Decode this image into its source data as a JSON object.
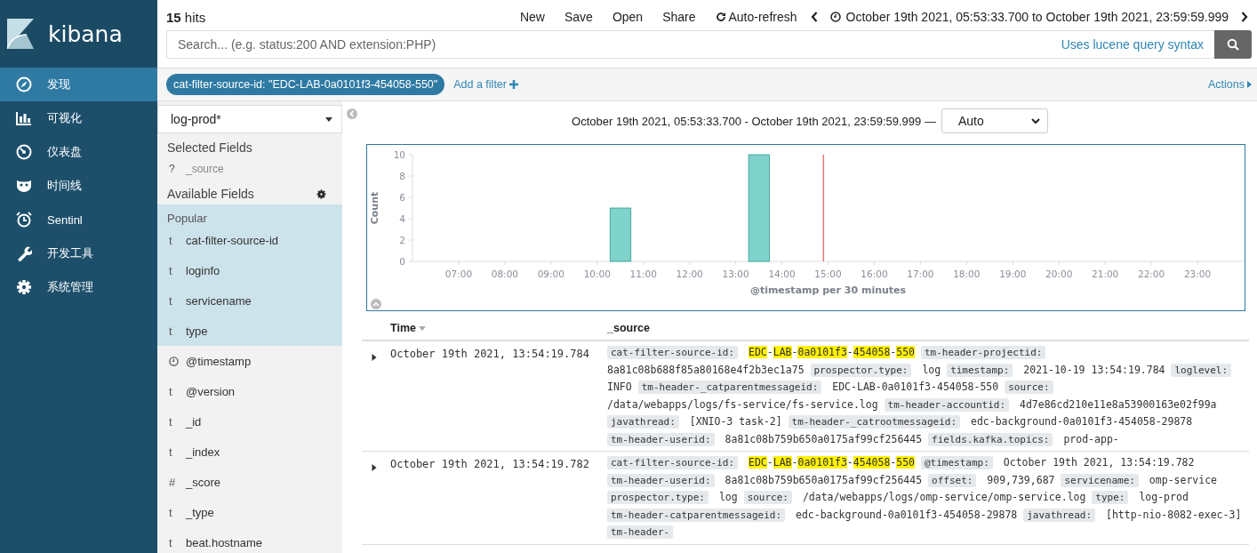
{
  "logo": {
    "text": "kibana"
  },
  "nav": [
    {
      "label": "发现",
      "kind": "discover",
      "selected": true
    },
    {
      "label": "可视化",
      "kind": "visualize",
      "selected": false
    },
    {
      "label": "仪表盘",
      "kind": "dashboard",
      "selected": false
    },
    {
      "label": "时间线",
      "kind": "timeline",
      "selected": false
    },
    {
      "label": "Sentinl",
      "kind": "alerts",
      "selected": false
    },
    {
      "label": "开发工具",
      "kind": "devtools",
      "selected": false
    },
    {
      "label": "系统管理",
      "kind": "management",
      "selected": false
    }
  ],
  "hits": "**15** hits",
  "menu": [
    {
      "label": "New",
      "kind": "plain"
    },
    {
      "label": "Save",
      "kind": "plain"
    },
    {
      "label": "Open",
      "kind": "plain"
    },
    {
      "label": "Share",
      "kind": "plain"
    },
    {
      "label": "Auto-refresh",
      "kind": "refresh"
    }
  ],
  "time_range": "October 19th 2021, 05:53:33.700 to October 19th 2021, 23:59:59.999",
  "search": {
    "placeholder": "Search... (e.g. status:200 AND extension:PHP)",
    "hint": "Uses lucene query syntax"
  },
  "filters": [
    {
      "label": "cat-filter-source-id: \"EDC-LAB-0a0101f3-454058-550\""
    }
  ],
  "add_filter": "Add a filter",
  "actions": "Actions",
  "index_pattern": "log-prod*",
  "selected_fields": {
    "title": "Selected Fields",
    "fields": [
      {
        "kind": "unknown",
        "type_label": "?",
        "name": "_source"
      }
    ]
  },
  "available_fields": {
    "title": "Available Fields",
    "popular_title": "Popular",
    "popular": [
      {
        "kind": "string",
        "type_label": "t",
        "name": "cat-filter-source-id"
      },
      {
        "kind": "string",
        "type_label": "t",
        "name": "loginfo"
      },
      {
        "kind": "string",
        "type_label": "t",
        "name": "servicename"
      },
      {
        "kind": "string",
        "type_label": "t",
        "name": "type"
      }
    ],
    "fields": [
      {
        "kind": "date",
        "name": "@timestamp"
      },
      {
        "kind": "string",
        "type_label": "t",
        "name": "@version"
      },
      {
        "kind": "string",
        "type_label": "t",
        "name": "_id"
      },
      {
        "kind": "string",
        "type_label": "t",
        "name": "_index"
      },
      {
        "kind": "number",
        "type_label": "#",
        "name": "_score"
      },
      {
        "kind": "string",
        "type_label": "t",
        "name": "_type"
      },
      {
        "kind": "string",
        "type_label": "t",
        "name": "beat.hostname"
      }
    ]
  },
  "histogram": {
    "range": "October 19th 2021, 05:53:33.700 - October 19th 2021, 23:59:59.999 —",
    "interval": "Auto",
    "chart_data": {
      "type": "bar",
      "xlabel": "@timestamp per 30 minutes",
      "ylabel": "Count",
      "x": [
        10.5,
        13.5
      ],
      "values": [
        5,
        10
      ],
      "ref_lines": [
        {
          "axis": "x",
          "value": 14.9
        }
      ],
      "xlim": [
        6,
        24
      ],
      "ylim": [
        0,
        10
      ],
      "yticks": [
        0,
        2,
        4,
        6,
        8,
        10
      ],
      "xticks": [
        {
          "value": 7,
          "label": "07:00"
        },
        {
          "value": 8,
          "label": "08:00"
        },
        {
          "value": 9,
          "label": "09:00"
        },
        {
          "value": 10,
          "label": "10:00"
        },
        {
          "value": 11,
          "label": "11:00"
        },
        {
          "value": 12,
          "label": "12:00"
        },
        {
          "value": 13,
          "label": "13:00"
        },
        {
          "value": 14,
          "label": "14:00"
        },
        {
          "value": 15,
          "label": "15:00"
        },
        {
          "value": 16,
          "label": "16:00"
        },
        {
          "value": 17,
          "label": "17:00"
        },
        {
          "value": 18,
          "label": "18:00"
        },
        {
          "value": 19,
          "label": "19:00"
        },
        {
          "value": 20,
          "label": "20:00"
        },
        {
          "value": 21,
          "label": "21:00"
        },
        {
          "value": 22,
          "label": "22:00"
        },
        {
          "value": 23,
          "label": "23:00"
        }
      ]
    }
  },
  "table": {
    "columns": [
      {
        "label": "Time",
        "sorted": true
      },
      {
        "label": "_source",
        "sorted": false
      }
    ],
    "rows": [
      {
        "time": "October 19th 2021, 13:54:19.784",
        "expanded": false,
        "fields": [
          {
            "key": "cat-filter-source-id:",
            "parts": [
              {
                "text": "EDC",
                "highlighted": true
              },
              {
                "text": "-",
                "highlighted": false
              },
              {
                "text": "LAB",
                "highlighted": true
              },
              {
                "text": "-",
                "highlighted": false
              },
              {
                "text": "0a0101f3",
                "highlighted": true
              },
              {
                "text": "-",
                "highlighted": false
              },
              {
                "text": "454058",
                "highlighted": true
              },
              {
                "text": "-",
                "highlighted": false
              },
              {
                "text": "550",
                "highlighted": true
              }
            ]
          },
          {
            "key": "tm-header-projectid:",
            "value": "8a81c08b688f85a80168e4f2b3ec1a75"
          },
          {
            "key": "prospector.type:",
            "value": "log"
          },
          {
            "key": "timestamp:",
            "value": "2021-10-19 13:54:19.784"
          },
          {
            "key": "loglevel:",
            "value": "INFO"
          },
          {
            "key": "tm-header-_catparentmessageid:",
            "value": "EDC-LAB-0a0101f3-454058-550"
          },
          {
            "key": "source:",
            "value": "/data/webapps/logs/fs-service/fs-service.log"
          },
          {
            "key": "tm-header-accountid:",
            "value": "4d7e86cd210e11e8a53900163e02f99a"
          },
          {
            "key": "javathread:",
            "value": "[XNIO-3 task-2]"
          },
          {
            "key": "tm-header-_catrootmessageid:",
            "value": "edc-background-0a0101f3-454058-29878"
          },
          {
            "key": "tm-header-userid:",
            "value": "8a81c08b759b650a0175af99cf256445"
          },
          {
            "key": "fields.kafka.topics:",
            "value": "prod-app-"
          }
        ]
      },
      {
        "time": "October 19th 2021, 13:54:19.782",
        "expanded": false,
        "fields": [
          {
            "key": "cat-filter-source-id:",
            "parts": [
              {
                "text": "EDC",
                "highlighted": true
              },
              {
                "text": "-",
                "highlighted": false
              },
              {
                "text": "LAB",
                "highlighted": true
              },
              {
                "text": "-",
                "highlighted": false
              },
              {
                "text": "0a0101f3",
                "highlighted": true
              },
              {
                "text": "-",
                "highlighted": false
              },
              {
                "text": "454058",
                "highlighted": true
              },
              {
                "text": "-",
                "highlighted": false
              },
              {
                "text": "550",
                "highlighted": true
              }
            ]
          },
          {
            "key": "@timestamp:",
            "value": "October 19th 2021, 13:54:19.782"
          },
          {
            "key": "tm-header-userid:",
            "value": "8a81c08b759b650a0175af99cf256445"
          },
          {
            "key": "offset:",
            "value": "909,739,687"
          },
          {
            "key": "servicename:",
            "value": "omp-service"
          },
          {
            "key": "prospector.type:",
            "value": "log"
          },
          {
            "key": "source:",
            "value": "/data/webapps/logs/omp-service/omp-service.log"
          },
          {
            "key": "type:",
            "value": "log-prod"
          },
          {
            "key": "tm-header-catparentmessageid:",
            "value": "edc-background-0a0101f3-454058-29878"
          },
          {
            "key": "javathread:",
            "value": "[http-nio-8082-exec-3]"
          },
          {
            "key": "tm-header-"
          }
        ]
      }
    ]
  }
}
